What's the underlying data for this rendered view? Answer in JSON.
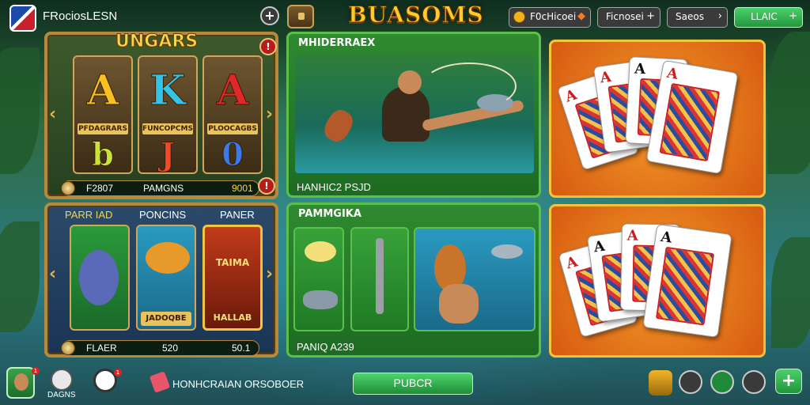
{
  "header": {
    "app_title": "FRociosLESN",
    "main_title": "BUASOMS",
    "add_label": "+",
    "pills": [
      {
        "label": "F0cHicoei",
        "icon": "gem-icon"
      },
      {
        "label": "Ficnosei",
        "icon": "plus-icon"
      },
      {
        "label": "Saeos",
        "icon": "arrow-icon"
      },
      {
        "label": "LLAIC",
        "icon": "plus-icon"
      }
    ]
  },
  "panels": {
    "slots": {
      "title": "UNGARS",
      "reels": [
        {
          "symbol": "A",
          "caption": "PFDAGRARS",
          "letter": "b"
        },
        {
          "symbol": "K",
          "caption": "FUNCOPCMS",
          "letter": "J"
        },
        {
          "symbol": "A",
          "caption": "PLOOCAGBS",
          "letter": "0"
        }
      ],
      "info": {
        "left": "F2807",
        "mid": "PAMGNS",
        "right": "9001"
      },
      "badge_top": "!",
      "badge_bottom": "!"
    },
    "fishing_top": {
      "title": "MHIDERRAEX",
      "caption": "HANHIC2 PSJD"
    },
    "cards_top": {
      "cards": [
        "A",
        "A",
        "A",
        "A",
        "A"
      ]
    },
    "fish_slots": {
      "headers": [
        "PARR IAD",
        "PONCINS",
        "PANER"
      ],
      "tile_caption": "JADOQBE",
      "tile_banner": "TAIMA",
      "tile_banner_2": "HALLAB",
      "info": {
        "left": "FLAER",
        "mid": "520",
        "right": "50.1"
      }
    },
    "fishing_bottom": {
      "title": "PAMMGIKA",
      "caption": "PANIQ A239"
    },
    "cards_bottom": {
      "cards": [
        "A",
        "A",
        "A",
        "A",
        "A"
      ]
    }
  },
  "footer": {
    "dagns_label": "DAGNS",
    "promo_text": "HONHCRAIAN ORSOBOER",
    "play_label": "PUBCR",
    "add_label": "+",
    "badge_avatar": "1",
    "badge_chat": "1"
  },
  "colors": {
    "gold": "#f7d54a",
    "green_btn": "#22963d",
    "orange_panel": "#d65a10"
  }
}
